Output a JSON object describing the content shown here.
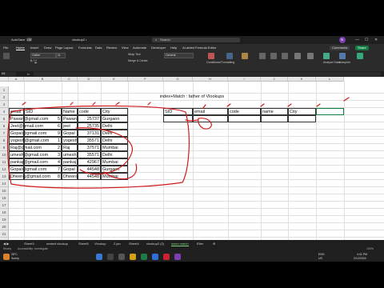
{
  "titlebar": {
    "autosave": "AutoSave",
    "autosave_state": "Off",
    "filename": "vlookup2 •",
    "search_placeholder": "Search",
    "avatar_initial": "N"
  },
  "menu": {
    "items": [
      "File",
      "Home",
      "Insert",
      "Draw",
      "Page Layout",
      "Formulas",
      "Data",
      "Review",
      "View",
      "Automate",
      "Developer",
      "Help",
      "AI-aided Formula Editor"
    ],
    "active": "Home",
    "comments": "Comments",
    "share": "Share"
  },
  "ribbon": {
    "font": "Calibri",
    "size": "11",
    "format": "General",
    "wrap": "Wrap Text",
    "merge": "Merge & Center",
    "groups": [
      "Conditional Formatting",
      "Format as Table",
      "Cell Styles",
      "Insert",
      "Delete",
      "Format",
      "Sort & Filter",
      "Find & Select",
      "Analyze Data",
      "Autopilot",
      "ChatGPT on Excel"
    ]
  },
  "formulabar": {
    "namebox": "N4",
    "fx": "fx"
  },
  "columns": [
    "A",
    "B",
    "C",
    "D",
    "E",
    "F",
    "G",
    "H",
    "I",
    "J",
    "K",
    "L"
  ],
  "rows": [
    "1",
    "2",
    "3",
    "4",
    "5",
    "6",
    "7",
    "8",
    "9",
    "10",
    "11",
    "12",
    "13",
    "14",
    "15",
    "16",
    "17",
    "18",
    "19",
    "20",
    "21",
    "22"
  ],
  "sheet": {
    "title": "index+Match : father of Vlookups",
    "left_headers": [
      "email",
      "SID",
      "Name",
      "code",
      "City"
    ],
    "records": [
      {
        "email": "Pawan@gmail.com",
        "sid": "5",
        "name": "Pawan",
        "code": "25737",
        "city": "Gurgaon"
      },
      {
        "email": "Jeet@gmail.com",
        "sid": "6",
        "name": "jeet",
        "code": "25735",
        "city": "Delhi"
      },
      {
        "email": "Gopal@gmail.com",
        "sid": "9",
        "name": "Gopal",
        "code": "37131",
        "city": "Delhi"
      },
      {
        "email": "yogesh@gmail.com",
        "sid": "1",
        "name": "yogesh",
        "code": "35571",
        "city": "Delhi"
      },
      {
        "email": "Raj@gmail.com",
        "sid": "2",
        "name": "Raj",
        "code": "37571",
        "city": "Mumbai"
      },
      {
        "email": "umesh@gmail.com",
        "sid": "3",
        "name": "umesh",
        "code": "35571",
        "city": "Delhi"
      },
      {
        "email": "pankaj@gmail.com",
        "sid": "4",
        "name": "pankaj",
        "code": "42967",
        "city": "Mumbai"
      },
      {
        "email": "Gopal@gmail.com",
        "sid": "7",
        "name": "Gopal",
        "code": "44548",
        "city": "Gurgaon"
      },
      {
        "email": "Dheeraj@gmail.com",
        "sid": "8",
        "name": "Dheeraj",
        "code": "44548",
        "city": "Mumbai"
      }
    ],
    "right_headers": [
      "SID",
      "email",
      "code",
      "name",
      "City"
    ]
  },
  "sheet_tabs": [
    "Sheet3",
    "nested vlookup",
    "Sheet5",
    "Vlookup",
    "2 jan",
    "Sheet4",
    "vlookup2 (2)",
    "index match",
    "Elter"
  ],
  "active_tab": "index match",
  "status": {
    "left": "Ready",
    "accessibility": "Accessibility: Investigate",
    "zoom": "100%"
  },
  "taskbar": {
    "weather_temp": "28°C",
    "weather_desc": "Sunny",
    "lang": "ENG",
    "region": "US",
    "time": "4:41 PM",
    "date": "2/12/2024"
  },
  "colors": {
    "accent": "#107c41",
    "ink": "#d11a1a"
  }
}
